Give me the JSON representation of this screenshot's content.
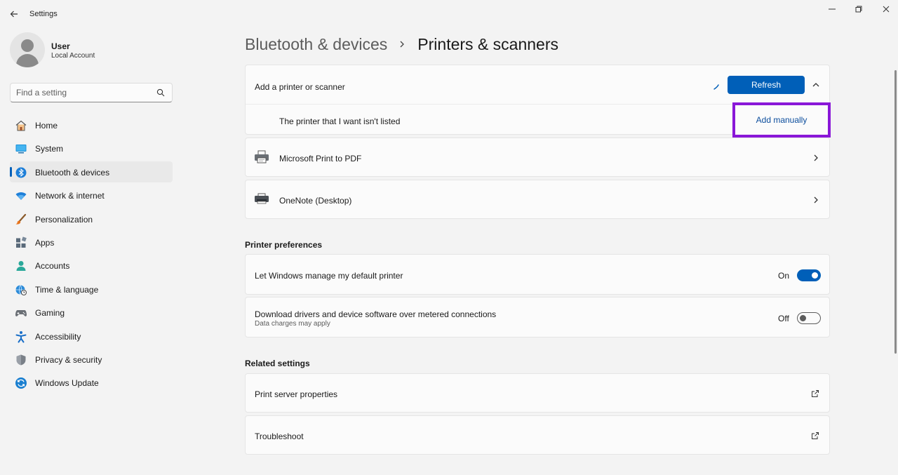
{
  "window": {
    "title": "Settings"
  },
  "profile": {
    "name": "User",
    "account_type": "Local Account"
  },
  "search": {
    "placeholder": "Find a setting"
  },
  "nav": {
    "items": [
      {
        "label": "Home",
        "icon": "home-icon"
      },
      {
        "label": "System",
        "icon": "system-icon"
      },
      {
        "label": "Bluetooth & devices",
        "icon": "bluetooth-icon",
        "active": true
      },
      {
        "label": "Network & internet",
        "icon": "wifi-icon"
      },
      {
        "label": "Personalization",
        "icon": "brush-icon"
      },
      {
        "label": "Apps",
        "icon": "apps-icon"
      },
      {
        "label": "Accounts",
        "icon": "accounts-icon"
      },
      {
        "label": "Time & language",
        "icon": "globe-clock-icon"
      },
      {
        "label": "Gaming",
        "icon": "gamepad-icon"
      },
      {
        "label": "Accessibility",
        "icon": "accessibility-icon"
      },
      {
        "label": "Privacy & security",
        "icon": "shield-icon"
      },
      {
        "label": "Windows Update",
        "icon": "update-icon"
      }
    ]
  },
  "breadcrumb": {
    "parent": "Bluetooth & devices",
    "current": "Printers & scanners"
  },
  "add_printer": {
    "label": "Add a printer or scanner",
    "refresh_label": "Refresh",
    "not_listed_label": "The printer that I want isn't listed",
    "add_manually_label": "Add manually"
  },
  "printers": [
    {
      "name": "Microsoft Print to PDF",
      "icon": "printer-icon"
    },
    {
      "name": "OneNote (Desktop)",
      "icon": "printer-icon"
    }
  ],
  "preferences": {
    "title": "Printer preferences",
    "items": [
      {
        "label": "Let Windows manage my default printer",
        "sublabel": "",
        "state": "On",
        "value": true
      },
      {
        "label": "Download drivers and device software over metered connections",
        "sublabel": "Data charges may apply",
        "state": "Off",
        "value": false
      }
    ]
  },
  "related": {
    "title": "Related settings",
    "items": [
      {
        "label": "Print server properties",
        "icon": "external-link-icon"
      },
      {
        "label": "Troubleshoot",
        "icon": "external-link-icon"
      }
    ]
  },
  "colors": {
    "accent": "#005fb8",
    "highlight_box": "#8a17d8",
    "background": "#f3f3f3",
    "card": "#fbfbfb"
  }
}
